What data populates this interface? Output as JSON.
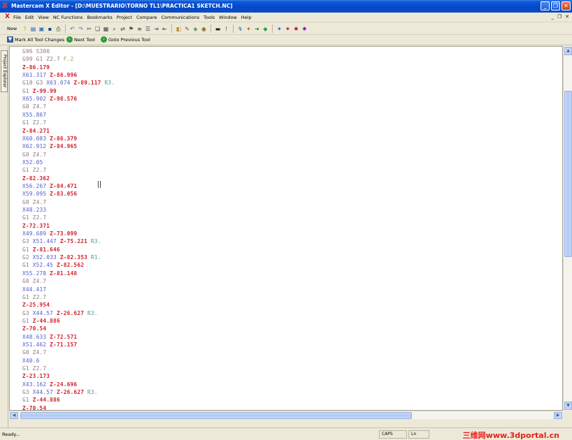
{
  "window": {
    "title": "Mastercam X Editor - [D:\\MUESTRARIO\\TORNO TL1\\PRACTICA1 SKETCH.NC]",
    "buttons": [
      "_",
      "❐",
      "✕"
    ]
  },
  "menubar": {
    "items": [
      "File",
      "Edit",
      "View",
      "NC Functions",
      "Bookmarks",
      "Project",
      "Compare",
      "Communications",
      "Tools",
      "Window",
      "Help"
    ],
    "right_controls": [
      "_",
      "❐",
      "✕"
    ]
  },
  "toolbar": {
    "new_label": "New",
    "icons": [
      "help-icon",
      "new-file-icon",
      "open-icon",
      "save-icon",
      "print-icon",
      "sep",
      "undo-icon",
      "redo-icon",
      "cut-icon",
      "copy-icon",
      "paste-icon",
      "find-icon",
      "find-replace-icon",
      "bookmark-icon",
      "renumber-icon",
      "align-icon",
      "indent-icon",
      "outdent-icon",
      "sep",
      "compile-icon",
      "tools-icon",
      "backplot-icon",
      "camera-icon",
      "sep",
      "terminal-icon",
      "info-icon",
      "sep",
      "nc-format-icon",
      "nc-options-icon",
      "nc-arrow-icon",
      "nc-green-icon",
      "sep",
      "star-blue-icon",
      "star-multi-icon",
      "star-red-icon",
      "star-purple-icon"
    ]
  },
  "toolbar2": {
    "mark_label": "Mark All Tool Changes",
    "next_label": "Next Tool",
    "prev_label": "Goto Previous Tool"
  },
  "sidetab": {
    "label": "Project Explorer"
  },
  "colors": {
    "g_code": "#8c7a84",
    "z_word": "#d2222e",
    "x_word": "#5060c8",
    "r_word": "#4a9a8c",
    "f_word": "#9a9a68"
  },
  "code_lines": [
    [
      {
        "t": "G96 S300",
        "c": "g"
      }
    ],
    [
      {
        "t": "G99 G1 Z2.7 ",
        "c": "g"
      },
      {
        "t": "F.2",
        "c": "f"
      }
    ],
    [
      {
        "t": "Z-86.179",
        "c": "z"
      }
    ],
    [
      {
        "t": "X61.317 ",
        "c": "x"
      },
      {
        "t": "Z-86.996",
        "c": "z"
      }
    ],
    [
      {
        "t": "G18 G3 ",
        "c": "g"
      },
      {
        "t": "X63.074 ",
        "c": "x"
      },
      {
        "t": "Z-89.117 ",
        "c": "z"
      },
      {
        "t": "R3.",
        "c": "r"
      }
    ],
    [
      {
        "t": "G1 ",
        "c": "g"
      },
      {
        "t": "Z-99.99",
        "c": "z"
      }
    ],
    [
      {
        "t": "X65.902 ",
        "c": "x"
      },
      {
        "t": "Z-98.576",
        "c": "z"
      }
    ],
    [
      {
        "t": "G0 Z4.7",
        "c": "g"
      }
    ],
    [
      {
        "t": "X55.867",
        "c": "x"
      }
    ],
    [
      {
        "t": "G1 Z2.7",
        "c": "g"
      }
    ],
    [
      {
        "t": "Z-84.271",
        "c": "z"
      }
    ],
    [
      {
        "t": "X60.083 ",
        "c": "x"
      },
      {
        "t": "Z-86.379",
        "c": "z"
      }
    ],
    [
      {
        "t": "X62.912 ",
        "c": "x"
      },
      {
        "t": "Z-84.965",
        "c": "z"
      }
    ],
    [
      {
        "t": "G0 Z4.7",
        "c": "g"
      }
    ],
    [
      {
        "t": "X52.05",
        "c": "x"
      }
    ],
    [
      {
        "t": "G1 Z2.7",
        "c": "g"
      }
    ],
    [
      {
        "t": "Z-82.362",
        "c": "z"
      }
    ],
    [
      {
        "t": "X56.267 ",
        "c": "x"
      },
      {
        "t": "Z-84.471",
        "c": "z"
      }
    ],
    [
      {
        "t": "X59.095 ",
        "c": "x"
      },
      {
        "t": "Z-83.056",
        "c": "z"
      }
    ],
    [
      {
        "t": "G0 Z4.7",
        "c": "g"
      }
    ],
    [
      {
        "t": "X48.233",
        "c": "x"
      }
    ],
    [
      {
        "t": "G1 Z2.7",
        "c": "g"
      }
    ],
    [
      {
        "t": "Z-72.371",
        "c": "z"
      }
    ],
    [
      {
        "t": "X49.689 ",
        "c": "x"
      },
      {
        "t": "Z-73.099",
        "c": "z"
      }
    ],
    [
      {
        "t": "G3 ",
        "c": "g"
      },
      {
        "t": "X51.447 ",
        "c": "x"
      },
      {
        "t": "Z-75.221 ",
        "c": "z"
      },
      {
        "t": "R3.",
        "c": "r"
      }
    ],
    [
      {
        "t": "G1 ",
        "c": "g"
      },
      {
        "t": "Z-81.646",
        "c": "z"
      }
    ],
    [
      {
        "t": "G2 ",
        "c": "g"
      },
      {
        "t": "X52.033 ",
        "c": "x"
      },
      {
        "t": "Z-82.353 ",
        "c": "z"
      },
      {
        "t": "R1.",
        "c": "r"
      }
    ],
    [
      {
        "t": "G1 ",
        "c": "g"
      },
      {
        "t": "X52.45 ",
        "c": "x"
      },
      {
        "t": "Z-82.562",
        "c": "z"
      }
    ],
    [
      {
        "t": "X55.278 ",
        "c": "x"
      },
      {
        "t": "Z-81.148",
        "c": "z"
      }
    ],
    [
      {
        "t": "G0 Z4.7",
        "c": "g"
      }
    ],
    [
      {
        "t": "X44.417",
        "c": "x"
      }
    ],
    [
      {
        "t": "G1 Z2.7",
        "c": "g"
      }
    ],
    [
      {
        "t": "Z-25.954",
        "c": "z"
      }
    ],
    [
      {
        "t": "G3 ",
        "c": "g"
      },
      {
        "t": "X44.57 ",
        "c": "x"
      },
      {
        "t": "Z-26.627 ",
        "c": "z"
      },
      {
        "t": "R3.",
        "c": "r"
      }
    ],
    [
      {
        "t": "G1 ",
        "c": "g"
      },
      {
        "t": "Z-44.886",
        "c": "z"
      }
    ],
    [
      {
        "t": "Z-70.54",
        "c": "z"
      }
    ],
    [
      {
        "t": "X48.633 ",
        "c": "x"
      },
      {
        "t": "Z-72.571",
        "c": "z"
      }
    ],
    [
      {
        "t": "X51.462 ",
        "c": "x"
      },
      {
        "t": "Z-71.157",
        "c": "z"
      }
    ],
    [
      {
        "t": "G0 Z4.7",
        "c": "g"
      }
    ],
    [
      {
        "t": "X40.6",
        "c": "x"
      }
    ],
    [
      {
        "t": "G1 Z2.7",
        "c": "g"
      }
    ],
    [
      {
        "t": "Z-23.173",
        "c": "z"
      }
    ],
    [
      {
        "t": "X43.162 ",
        "c": "x"
      },
      {
        "t": "Z-24.696",
        "c": "z"
      }
    ],
    [
      {
        "t": "G3 ",
        "c": "g"
      },
      {
        "t": "X44.57 ",
        "c": "x"
      },
      {
        "t": "Z-26.627 ",
        "c": "z"
      },
      {
        "t": "R3.",
        "c": "r"
      }
    ],
    [
      {
        "t": "G1 ",
        "c": "g"
      },
      {
        "t": "Z-44.886",
        "c": "z"
      }
    ],
    [
      {
        "t": "Z-70.54",
        "c": "z"
      }
    ]
  ],
  "statusbar": {
    "ready": "Ready...",
    "caps": "CAPS",
    "line_col": "Ln",
    "watermark": "三维网www.3dportal.cn"
  }
}
